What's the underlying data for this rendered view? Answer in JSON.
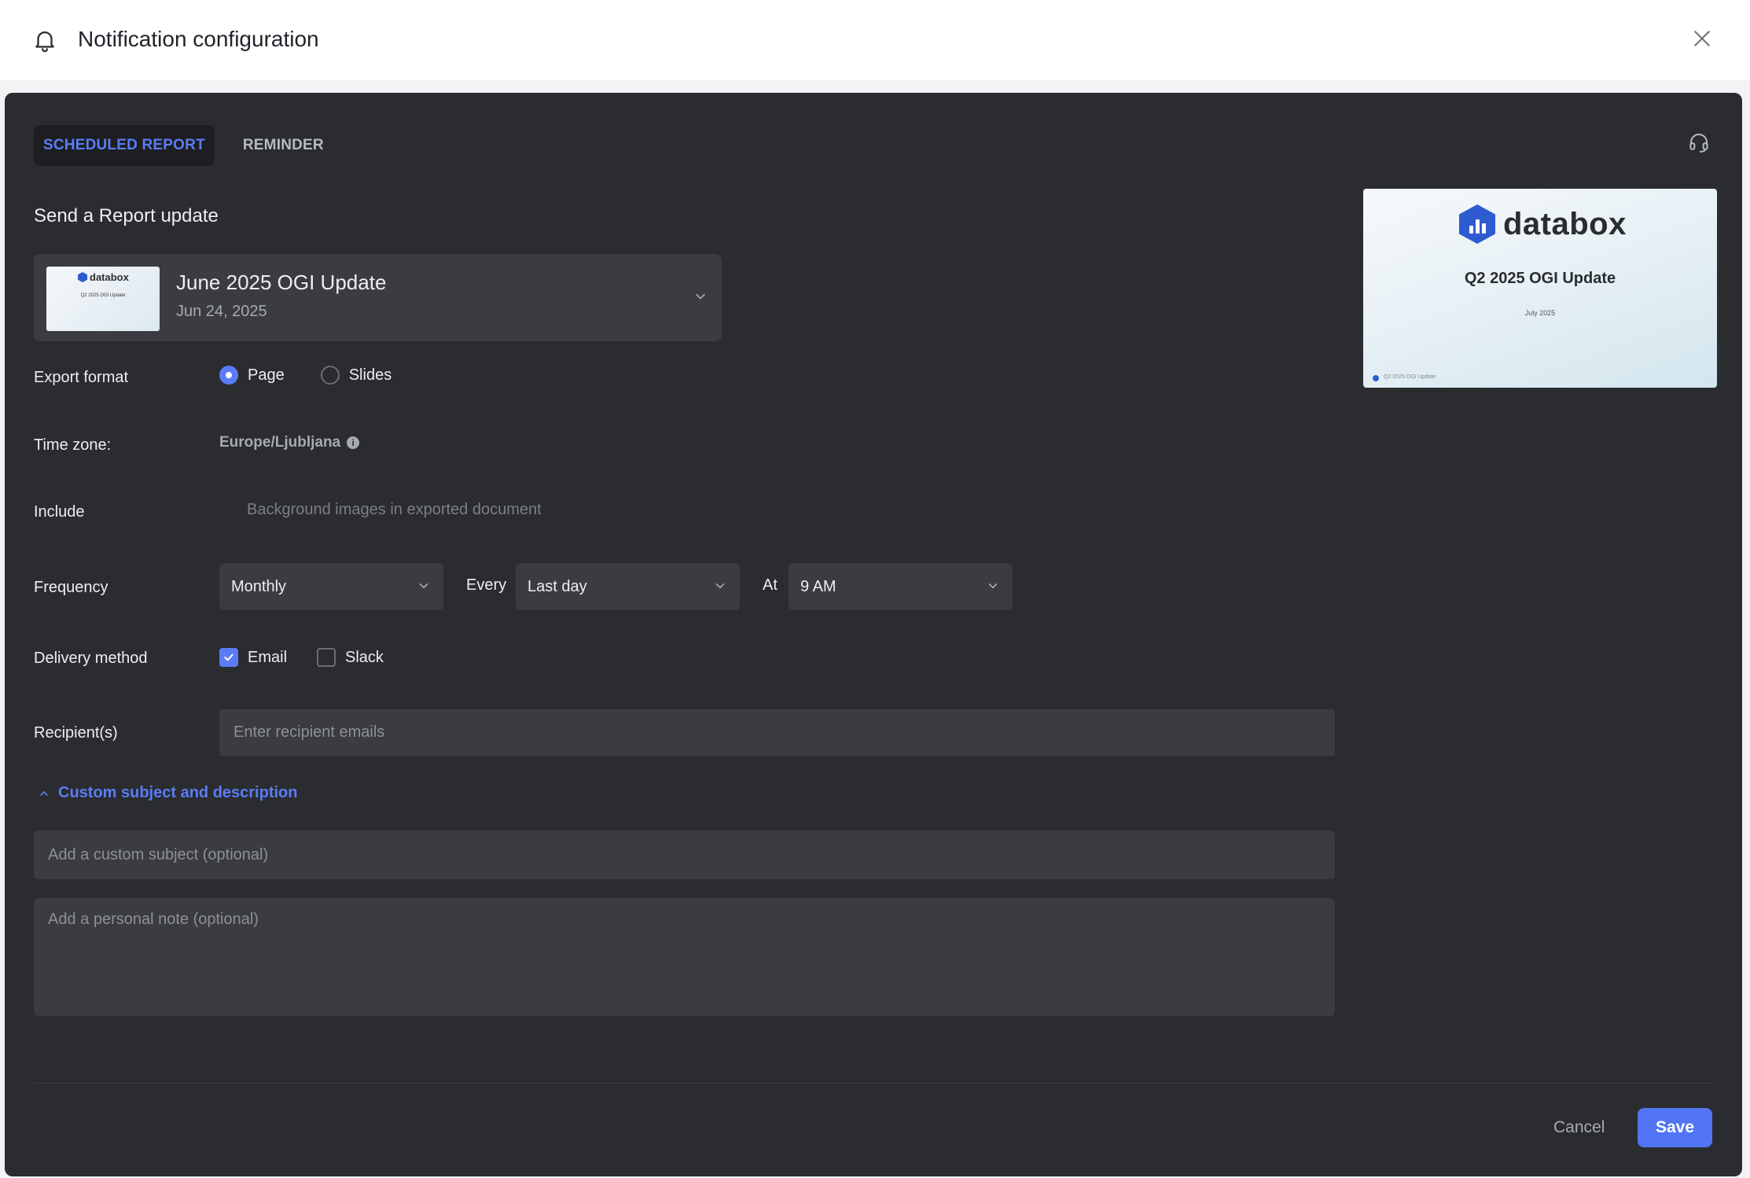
{
  "header": {
    "title": "Notification configuration",
    "icon": "bell-icon",
    "close_icon": "close-icon"
  },
  "tabs": [
    {
      "label": "SCHEDULED REPORT",
      "active": true
    },
    {
      "label": "REMINDER",
      "active": false
    }
  ],
  "support_icon": "headset-icon",
  "section_title": "Send a Report update",
  "report": {
    "name": "June 2025 OGI Update",
    "date": "Jun 24, 2025",
    "thumb_brand": "databox",
    "thumb_title": "Q2 2025 OGI Update"
  },
  "export_format": {
    "label": "Export format",
    "options": [
      "Page",
      "Slides"
    ],
    "selected": "Page"
  },
  "time_zone": {
    "label": "Time zone:",
    "value": "Europe/Ljubljana"
  },
  "include": {
    "label": "Include",
    "text": "Background images in exported document"
  },
  "frequency": {
    "label": "Frequency",
    "value": "Monthly",
    "every_label": "Every",
    "every_value": "Last day",
    "at_label": "At",
    "at_value": "9 AM"
  },
  "delivery": {
    "label": "Delivery method",
    "options": [
      {
        "label": "Email",
        "checked": true
      },
      {
        "label": "Slack",
        "checked": false
      }
    ]
  },
  "recipients": {
    "label": "Recipient(s)",
    "placeholder": "Enter recipient emails"
  },
  "custom": {
    "toggle_label": "Custom subject and description",
    "subject_placeholder": "Add a custom subject (optional)",
    "note_placeholder": "Add a personal note (optional)"
  },
  "footer": {
    "cancel": "Cancel",
    "save": "Save"
  },
  "preview": {
    "brand": "databox",
    "title": "Q2 2025 OGI Update",
    "date": "July 2025",
    "footer_text": "Q2 2025 OGI Update"
  },
  "colors": {
    "accent": "#5b7cf6",
    "panel": "#2a2c30",
    "field": "#3a3c41"
  }
}
